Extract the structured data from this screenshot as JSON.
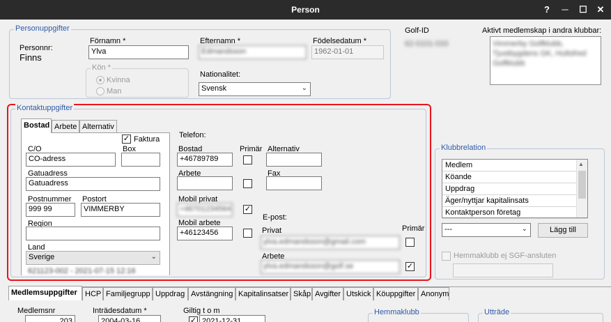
{
  "window": {
    "title": "Person",
    "help_label": "?"
  },
  "personuppgifter": {
    "legend": "Personuppgifter",
    "personnr_label": "Personnr:",
    "personnr_value": "Finns",
    "fornamn_label": "Förnamn *",
    "fornamn_value": "Ylva",
    "efternamn_label": "Efternamn *",
    "efternamn_value": "Edmandsson",
    "fodelsedatum_label": "Födelsedatum *",
    "fodelsedatum_value": "1962-01-01",
    "kon_label": "Kön *",
    "kon_options": [
      "Kvinna",
      "Man"
    ],
    "nationalitet_label": "Nationalitet:",
    "nationalitet_value": "Svensk"
  },
  "golf_id": {
    "label": "Golf-ID",
    "value": "62-0101-033"
  },
  "aktivt": {
    "label": "Aktivt medlemskap i andra klubbar:",
    "value": "Vimmerby Golfklubb, Tjustbygdens GK, Hultsfred Golfklubb"
  },
  "kontakt": {
    "legend": "Kontaktuppgifter",
    "tabs": [
      "Bostad",
      "Arbete",
      "Alternativ"
    ],
    "faktura_label": "Faktura",
    "co_label": "C/O",
    "co_value": "CO-adress",
    "box_label": "Box",
    "box_value": "",
    "gatuadress_label": "Gatuadress",
    "gatuadress_value": "Gatuadress",
    "postnummer_label": "Postnummer",
    "postnummer_value": "999 99",
    "postort_label": "Postort",
    "postort_value": "VIMMERBY",
    "region_label": "Region",
    "region_value": "",
    "land_label": "Land",
    "land_value": "Sverige",
    "footer_text": "621123-002 - 2021-07-15 12:16",
    "telefon_label": "Telefon:",
    "primar_label": "Primär",
    "bostad_label": "Bostad",
    "bostad_value": "+46789789",
    "alternativ_label": "Alternativ",
    "alternativ_value": "",
    "arbete_label": "Arbete",
    "arbete_value": "",
    "fax_label": "Fax",
    "fax_value": "",
    "mobil_privat_label": "Mobil privat",
    "mobil_privat_value": "+46701234564",
    "mobil_arbete_label": "Mobil arbete",
    "mobil_arbete_value": "+46123456",
    "epost_label": "E-post:",
    "privat_label": "Privat",
    "privat_value": "ylva.edmandsson@gmail.com",
    "epost_primar_label": "Primär",
    "epost_arbete_label": "Arbete",
    "epost_arbete_value": "ylva.edmandsson@golf.se"
  },
  "klubbrelation": {
    "legend": "Klubbrelation",
    "items": [
      "Medlem",
      "Köande",
      "Uppdrag",
      "Äger/nyttjar kapitalinsats",
      "Kontaktperson företag"
    ],
    "select_value": "---",
    "add_button": "Lägg till",
    "hemmaklubb_label": "Hemmaklubb ej SGF-ansluten"
  },
  "bottom_tabs": [
    "Medlemsuppgifter",
    "HCP",
    "Familjegrupp",
    "Uppdrag",
    "Avstängning",
    "Kapitalinsatser",
    "Skåp",
    "Avgifter",
    "Utskick",
    "Köuppgifter",
    "Anonym"
  ],
  "medlem": {
    "medlemsnr_label": "Medlemsnr",
    "medlemsnr_value": "203",
    "intradesdatum_label": "Inträdesdatum *",
    "intradesdatum_value": "2004-03-16",
    "giltig_label": "Giltig t o m",
    "giltig_value": "2021-12-31",
    "hemmaklubb_legend": "Hemmaklubb",
    "uttrade_legend": "Utträde"
  }
}
